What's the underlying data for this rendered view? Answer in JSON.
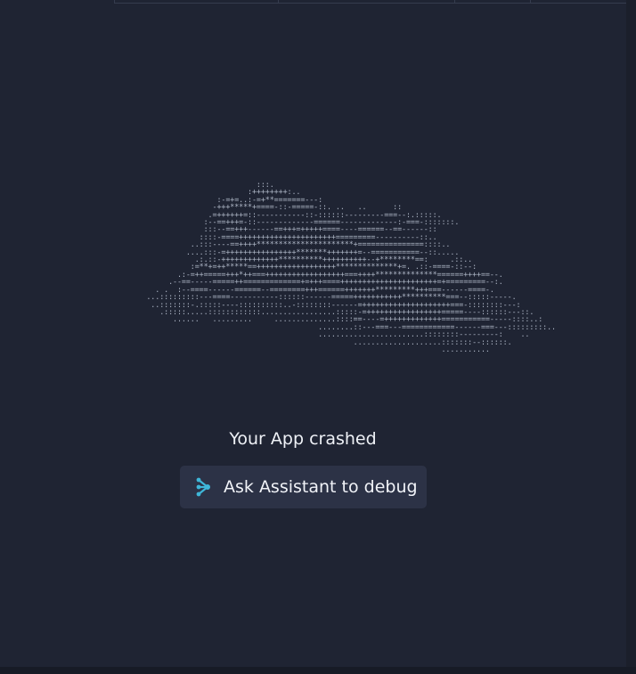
{
  "ascii_art": "                                    :::.\n                                  :++++++++:..\n                           :-=+=..:-=+**=======---:\n                          -+++*****+====-::-=====-::. ..   ..      ::\n                         .=++++++=::-----------::-::::::---------===--:.:::::.\n                        :--==+++=-::-------------======-------------:-===-:::::::.\n                        :::--==+++------==+++=+++++====----======--==------::\n                       ::::-====++++++++++++++++++++++=========----------::..\n                     ..:::----==++++**********************+===============::::..\n                    ....:::-=++++++++++++++++*******+++++++=--===========--::.....\n                      .:.::-+++++++++++++**********++++++++++--+********==:     .::..\n                     :=**+=++*****==++++++++++++++++++**************+=. .::-====-::--:\n                  .:-=++=====+++*++===++++++++++++++++++===++++**************======++++==--.\n                .--==-----=====++=============+=+++====++++++++++++++++++++++=+=========--:.\n             . .  :--====------======--========+++======+++++++*********+++===------====-.\n           ...:::::::::---====-----------::::::------=====+++++++++++**********===--:::::-----.\n            ..:::::::-.:::::----::::::::::..-::::::::------=++++++++++++++++++++===-::::::::---:\n              .:::::.....::::::::::::.................:::::-=+++++++++++++++++=====----::::::---::.\n                 ......   .........     ..............::::==----=+++++++++++++===========-----::::..:\n                                                  ........::---===---============------===---:::::::::..\n                                                  ........................::::::::---------:    ..\n                                                          ....................:::::::--::::::.\n                                                                              ...........",
  "crash_message": "Your App crashed",
  "debug_button": {
    "label": "Ask Assistant to debug",
    "icon": "assistant-logo-icon",
    "icon_color": "#3fb6d8"
  },
  "colors": {
    "background": "#1f2433",
    "button_bg": "#2c3246",
    "text": "#eef1f6",
    "ascii": "#aeb6c6"
  }
}
